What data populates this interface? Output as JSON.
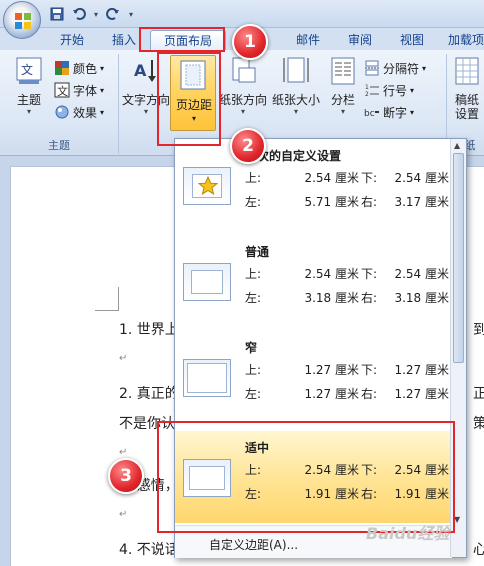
{
  "qat": {
    "save_icon": "save-icon",
    "undo_icon": "undo-icon",
    "redo_icon": "redo-icon"
  },
  "tabs": [
    {
      "label": "开始"
    },
    {
      "label": "插入"
    },
    {
      "label": "页面布局"
    },
    {
      "label": "邮件"
    },
    {
      "label": "审阅"
    },
    {
      "label": "视图"
    },
    {
      "label": "加载项"
    }
  ],
  "ribbon": {
    "themes": {
      "label": "主题",
      "group_label": "主题",
      "colors": "颜色",
      "fonts": "字体",
      "effects": "效果"
    },
    "page_setup": {
      "text_direction": "文字方向",
      "margins": "页边距",
      "orientation": "纸张方向",
      "size": "纸张大小",
      "columns": "分栏",
      "breaks": "分隔符",
      "line_numbers": "行号",
      "hyphenation": "断字"
    },
    "paper": {
      "label": "稿纸",
      "label2": "设置",
      "group_label": "纸"
    }
  },
  "document": {
    "lines": [
      {
        "text": "1. 世界上",
        "tail": "到"
      },
      {
        "text": "2. 真正的",
        "tail": "正"
      },
      {
        "text": "不是你认",
        "tail": "策"
      },
      {
        "text": "3. 感情，",
        "tail": ""
      },
      {
        "text": "4. 不说话",
        "tail": "心"
      }
    ]
  },
  "dropdown": {
    "presets": [
      {
        "title": "上次的自定义设置",
        "top_label": "上:",
        "top": "2.54 厘米",
        "bottom_label": "下:",
        "bottom": "2.54 厘米",
        "left_label": "左:",
        "left": "5.71 厘米",
        "right_label": "右:",
        "right": "3.17 厘米"
      },
      {
        "title": "普通",
        "top_label": "上:",
        "top": "2.54 厘米",
        "bottom_label": "下:",
        "bottom": "2.54 厘米",
        "left_label": "左:",
        "left": "3.18 厘米",
        "right_label": "右:",
        "right": "3.18 厘米"
      },
      {
        "title": "窄",
        "top_label": "上:",
        "top": "1.27 厘米",
        "bottom_label": "下:",
        "bottom": "1.27 厘米",
        "left_label": "左:",
        "left": "1.27 厘米",
        "right_label": "右:",
        "right": "1.27 厘米"
      },
      {
        "title": "适中",
        "top_label": "上:",
        "top": "2.54 厘米",
        "bottom_label": "下:",
        "bottom": "2.54 厘米",
        "left_label": "左:",
        "left": "1.91 厘米",
        "right_label": "右:",
        "right": "1.91 厘米"
      }
    ],
    "custom": "自定义边距(A)..."
  },
  "annotations": {
    "step1": "1",
    "step2": "2",
    "step3": "3"
  },
  "watermark": "Baidu经验",
  "colors": {
    "accent_red": "#e3262c",
    "highlight": "#ffd66e",
    "tab_text": "#15428b"
  }
}
